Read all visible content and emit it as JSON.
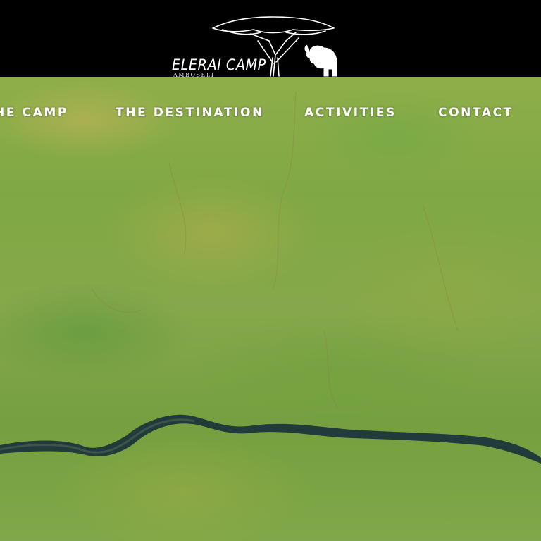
{
  "header": {
    "logo_title": "ELERAI CAMP",
    "logo_subtitle": "AMBOSELI"
  },
  "nav": {
    "items": [
      {
        "label": "HE CAMP"
      },
      {
        "label": "THE DESTINATION"
      },
      {
        "label": "ACTIVITIES"
      },
      {
        "label": "CONTACT"
      }
    ]
  },
  "colors": {
    "header_bg": "#000000",
    "nav_text": "#ffffff",
    "grass": "#80a848",
    "river": "#1e3a3a"
  },
  "icons": {
    "tree": "acacia-tree-icon",
    "elephant": "elephant-icon"
  }
}
